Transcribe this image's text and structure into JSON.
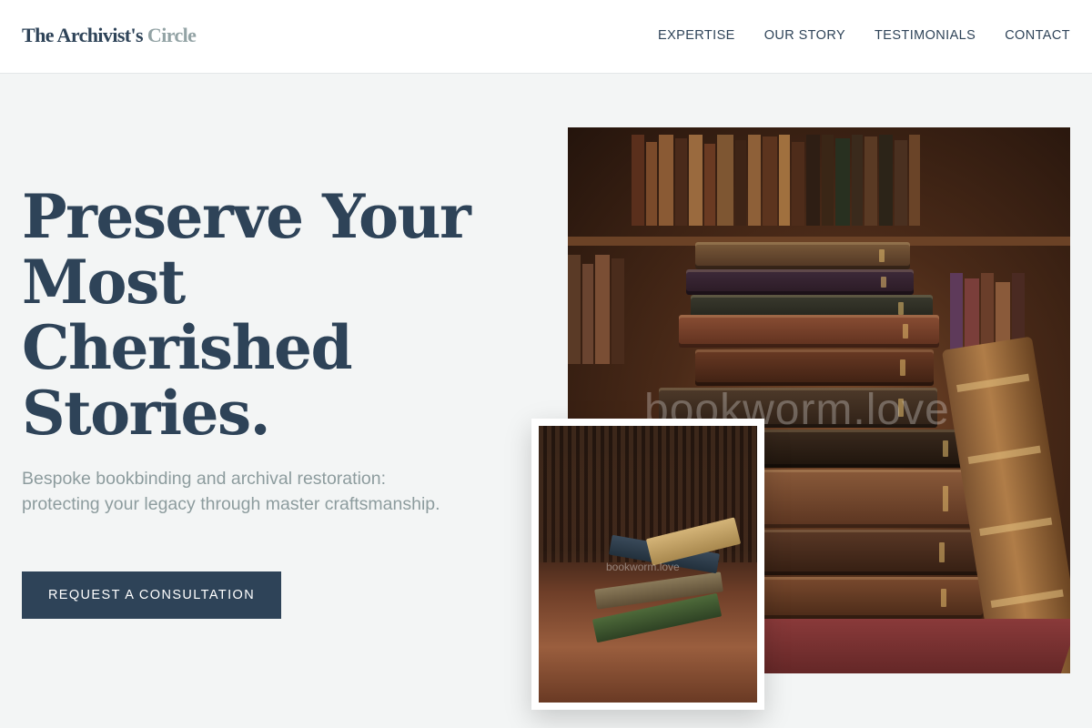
{
  "brand": {
    "name_main": "The Archivist's",
    "name_accent": "Circle"
  },
  "nav": {
    "items": [
      {
        "label": "EXPERTISE"
      },
      {
        "label": "OUR STORY"
      },
      {
        "label": "TESTIMONIALS"
      },
      {
        "label": "CONTACT"
      }
    ]
  },
  "hero": {
    "title_lines": [
      "Preserve Your",
      "Most",
      "Cherished",
      "Stories."
    ],
    "subtitle": "Bespoke bookbinding and archival restoration: protecting your legacy through master craftsmanship.",
    "cta_label": "REQUEST A CONSULTATION"
  },
  "images": {
    "main_watermark": "bookworm.love",
    "inset_watermark": "bookworm.love"
  },
  "colors": {
    "primary": "#2e4358",
    "accent": "#93a3a5",
    "background": "#f3f5f5",
    "header_bg": "#ffffff",
    "button_text": "#ffffff"
  }
}
